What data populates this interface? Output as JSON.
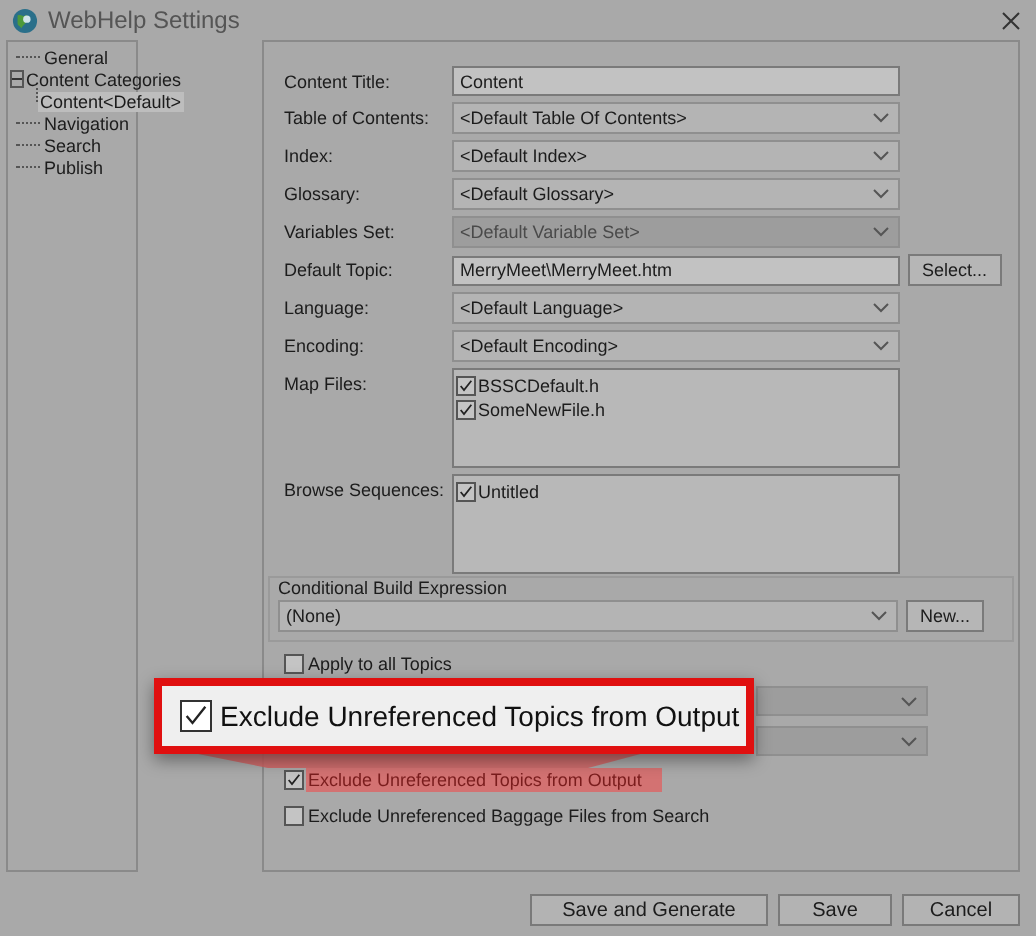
{
  "window": {
    "title": "WebHelp Settings"
  },
  "tree": [
    {
      "label": "General",
      "selected": false
    },
    {
      "label": "Content Categories",
      "selected": false,
      "expanded": true,
      "children": [
        {
          "label": "Content<Default>",
          "selected": true
        }
      ]
    },
    {
      "label": "Navigation",
      "selected": false
    },
    {
      "label": "Search",
      "selected": false
    },
    {
      "label": "Publish",
      "selected": false
    }
  ],
  "fields": [
    {
      "kind": "text",
      "label": "Content Title:",
      "value": "Content"
    },
    {
      "kind": "dropdown",
      "label": "Table of Contents:",
      "value": "<Default Table Of Contents>",
      "disabled": false
    },
    {
      "kind": "dropdown",
      "label": "Index:",
      "value": "<Default Index>",
      "disabled": false
    },
    {
      "kind": "dropdown",
      "label": "Glossary:",
      "value": "<Default Glossary>",
      "disabled": false
    },
    {
      "kind": "dropdown",
      "label": "Variables Set:",
      "value": "<Default Variable Set>",
      "disabled": true
    },
    {
      "kind": "text",
      "label": "Default Topic:",
      "value": "MerryMeet\\MerryMeet.htm",
      "button": "Select..."
    },
    {
      "kind": "dropdown",
      "label": "Language:",
      "value": "<Default Language>",
      "disabled": false
    },
    {
      "kind": "dropdown",
      "label": "Encoding:",
      "value": "<Default Encoding>",
      "disabled": false
    },
    {
      "kind": "list",
      "label": "Map Files:",
      "items": [
        {
          "label": "BSSCDefault.h",
          "checked": true
        },
        {
          "label": "SomeNewFile.h",
          "checked": true
        }
      ]
    },
    {
      "kind": "list",
      "label": "Browse Sequences:",
      "items": [
        {
          "label": "Untitled",
          "checked": true
        }
      ]
    }
  ],
  "conditional_build": {
    "title": "Conditional Build Expression",
    "value": "(None)",
    "button": "New..."
  },
  "options": [
    {
      "kind": "checkbox",
      "label": "Apply to all Topics",
      "checked": false,
      "highlighted": false
    },
    {
      "kind": "dropdown",
      "disabled": true
    },
    {
      "kind": "dropdown",
      "disabled": true
    },
    {
      "kind": "checkbox",
      "label": "Exclude Unreferenced Topics from Output",
      "checked": true,
      "highlighted": true
    },
    {
      "kind": "checkbox",
      "label": "Exclude Unreferenced Baggage Files from Search",
      "checked": false,
      "highlighted": false
    }
  ],
  "callout": {
    "label": "Exclude Unreferenced Topics from Output",
    "checked": true
  },
  "buttons": [
    "Save and Generate",
    "Save",
    "Cancel"
  ]
}
